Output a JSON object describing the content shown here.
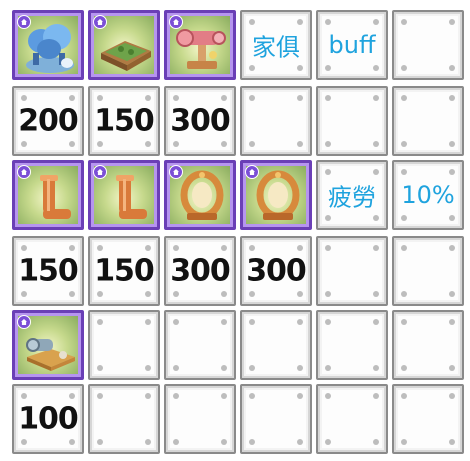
{
  "colors": {
    "item_border": "#6a3fb6",
    "note_text": "#1fa3de",
    "price_text": "#111111"
  },
  "furniture": [
    {
      "icon": "blue-tree-fountain-icon",
      "price": "200"
    },
    {
      "icon": "garden-bed-icon",
      "price": "150"
    },
    {
      "icon": "pink-telescope-icon",
      "price": "300"
    },
    {
      "icon": "copper-pipe-icon",
      "price": "150"
    },
    {
      "icon": "copper-pipe-icon",
      "price": "150"
    },
    {
      "icon": "golden-ring-frame-icon",
      "price": "300"
    },
    {
      "icon": "golden-ring-frame-icon",
      "price": "300"
    },
    {
      "icon": "workbench-cannon-icon",
      "price": "100"
    }
  ],
  "notes": {
    "furniture_label": "家俱",
    "furniture_value": "buff",
    "fatigue_label": "疲勞",
    "fatigue_value": "10%"
  }
}
